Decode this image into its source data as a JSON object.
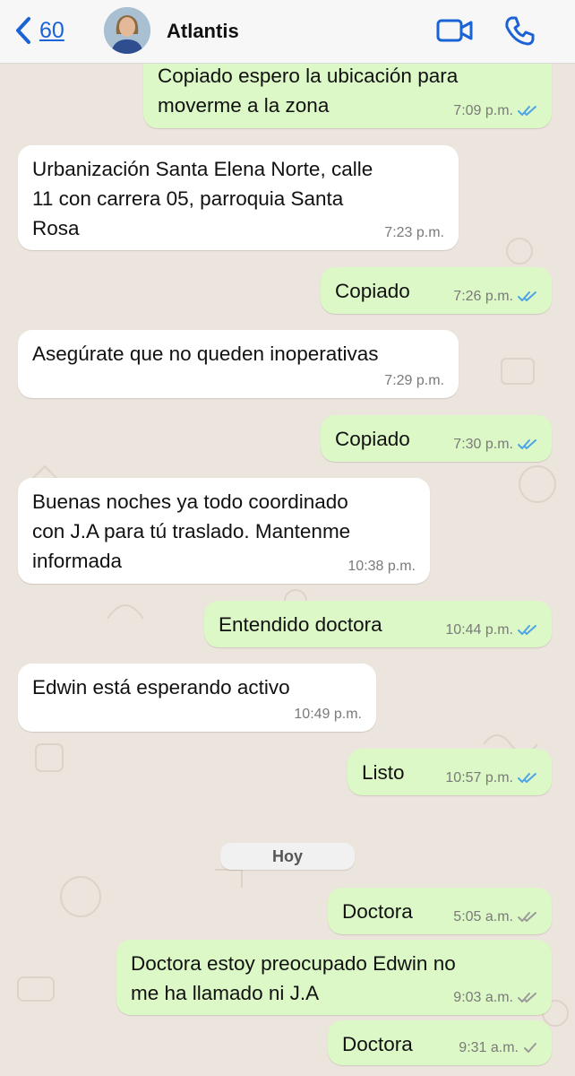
{
  "header": {
    "back_count": "60",
    "contact_name": "Atlantis"
  },
  "colors": {
    "accent": "#1a63d6",
    "outgoing_bubble": "#dcf8c6",
    "incoming_bubble": "#ffffff",
    "read_tick": "#4fa3e6",
    "unread_tick": "#9a9a9a"
  },
  "messages": [
    {
      "direction": "out",
      "text": "Copiado espero la ubicación para\nmoverme a la zona",
      "time": "7:09 p.m.",
      "status": "read"
    },
    {
      "direction": "in",
      "text": "Urbanización Santa Elena Norte, calle\n11 con carrera 05, parroquia Santa\nRosa",
      "time": "7:23 p.m."
    },
    {
      "direction": "out",
      "text": "Copiado",
      "time": "7:26 p.m.",
      "status": "read"
    },
    {
      "direction": "in",
      "text": "Asegúrate que no queden inoperativas",
      "time": "7:29 p.m."
    },
    {
      "direction": "out",
      "text": "Copiado",
      "time": "7:30 p.m.",
      "status": "read"
    },
    {
      "direction": "in",
      "text": "Buenas noches ya todo coordinado\ncon J.A para tú traslado. Mantenme\ninformada",
      "time": "10:38 p.m."
    },
    {
      "direction": "out",
      "text": "Entendido doctora",
      "time": "10:44 p.m.",
      "status": "read"
    },
    {
      "direction": "in",
      "text": "Edwin está esperando activo",
      "time": "10:49 p.m."
    },
    {
      "direction": "out",
      "text": "Listo",
      "time": "10:57 p.m.",
      "status": "read"
    },
    {
      "direction": "out",
      "text": "Doctora",
      "time": "5:05 a.m.",
      "status": "delivered"
    },
    {
      "direction": "out",
      "text": "Doctora estoy preocupado Edwin no\nme ha llamado ni J.A",
      "time": "9:03 a.m.",
      "status": "delivered"
    },
    {
      "direction": "out",
      "text": "Doctora",
      "time": "9:31 a.m.",
      "status": "sent"
    }
  ],
  "day_separator": "Hoy"
}
